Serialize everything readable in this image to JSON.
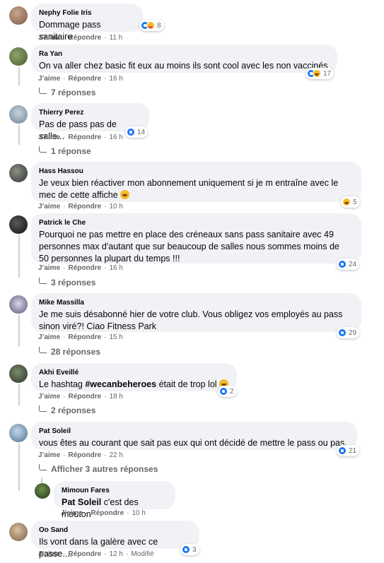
{
  "labels": {
    "like": "J’aime",
    "reply": "Répondre",
    "dot": "·"
  },
  "comments": [
    {
      "author": "Nephy Folie Iris",
      "text": "Dommage pass sanitaire",
      "time": "11 h",
      "reactions": "8"
    },
    {
      "author": "Ra Yan",
      "text": "On va aller chez basic fit eux au moins ils sont cool avec les non vaccinés",
      "time": "16 h",
      "reactions": "17",
      "replies": "7 réponses"
    },
    {
      "author": "Thierry Perez",
      "text": "Pas de pass pas de salle...",
      "time": "16 h",
      "reactions": "14",
      "replies": "1 réponse"
    },
    {
      "author": "Hass Hassou",
      "text_line1": "Je veux bien réactiver mon abonnement uniquement si je m entraîne avec le",
      "text_line2": "mec de cette affiche",
      "time": "10 h",
      "reactions": "5"
    },
    {
      "author": "Patrick le Che",
      "text_line1": "Pourquoi ne pas mettre en place des créneaux sans pass sanitaire avec 49",
      "text_line2": "personnes max d'autant que sur beaucoup de salles nous sommes moins de",
      "text_line3": "50 personnes la plupart du temps !!!",
      "time": "16 h",
      "reactions": "24",
      "replies": "3 réponses"
    },
    {
      "author": "Mike Massilla",
      "text_line1": "Je me suis désabonné hier de votre club. Vous obligez vos employés au pass",
      "text_line2": "sinon viré?! Ciao Fitness Park",
      "time": "15 h",
      "reactions": "29",
      "replies": "28 réponses"
    },
    {
      "author": "Akhi Eveillé",
      "text_pre": "Le hashtag ",
      "hashtag": "#wecanbeheroes",
      "text_post": " était de trop lol",
      "time": "18 h",
      "reactions": "2",
      "replies": "2 réponses"
    },
    {
      "author": "Pat Soleil",
      "text": "vous êtes au courant que sait pas eux qui ont décidé de mettre le pass ou pas.",
      "time": "22 h",
      "reactions": "21",
      "replies": "Afficher 3 autres réponses"
    },
    {
      "author": "Mimoun Fares",
      "mention": "Pat Soleil",
      "text": " c'est des mouton",
      "time": "10 h"
    },
    {
      "author": "Oo Sand",
      "text": "Ils vont dans la galère avec ce passe....",
      "time": "12 h",
      "edited": "Modifié",
      "reactions": "3"
    }
  ],
  "colors": {
    "bubble": "#f0f2f5",
    "meta": "#65676b",
    "like_blue": "#1877f2",
    "emoji_yellow": "#f7b928"
  },
  "icons": [
    "like-icon",
    "haha-icon",
    "wow-icon",
    "care-icon",
    "reply-arrow-icon"
  ]
}
